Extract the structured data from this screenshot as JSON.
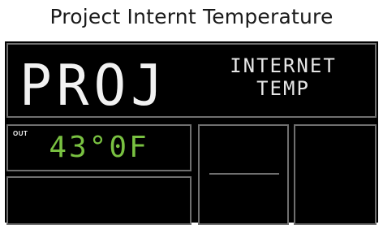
{
  "title": "Project Internt Temperature",
  "display": {
    "big_label": "PROJ",
    "header_lines": [
      "INTERNET",
      "TEMP"
    ],
    "out_label": "OUT",
    "temperature": "43°0F",
    "colors": {
      "background": "#000000",
      "segment_white": "#f2f2f2",
      "temperature_green": "#79c141",
      "border_gray": "#6f6f6f"
    }
  }
}
